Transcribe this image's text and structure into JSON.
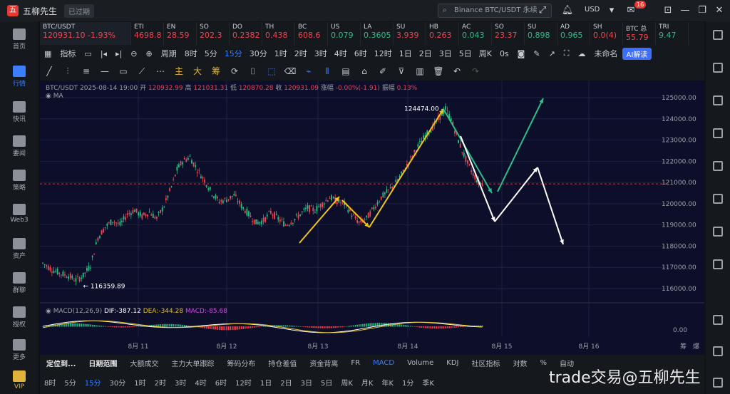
{
  "app": {
    "title": "五柳先生",
    "expired_label": "已过期"
  },
  "search": {
    "placeholder": "Binance BTC/USDT 永续"
  },
  "header": {
    "currency": "USD",
    "notif_count": "16"
  },
  "sidebar": {
    "items": [
      {
        "label": "首页"
      },
      {
        "label": "行情"
      },
      {
        "label": "快讯"
      },
      {
        "label": "要闻"
      },
      {
        "label": "策略"
      },
      {
        "label": "Web3"
      },
      {
        "label": "资产"
      },
      {
        "label": "群聊"
      },
      {
        "label": "授权"
      },
      {
        "label": "更多"
      },
      {
        "label": "VIP"
      }
    ]
  },
  "tickers": [
    {
      "sym": "BTC/USDT",
      "px": "120931.10 -1.93%",
      "dir": "red"
    },
    {
      "sym": "ETI",
      "px": "4698.8",
      "dir": "red"
    },
    {
      "sym": "EN",
      "px": "28.59",
      "dir": "red"
    },
    {
      "sym": "SO",
      "px": "202.3",
      "dir": "red"
    },
    {
      "sym": "DO",
      "px": "0.2382",
      "dir": "red"
    },
    {
      "sym": "TH",
      "px": "0.438",
      "dir": "red"
    },
    {
      "sym": "BC",
      "px": "608.6",
      "dir": "red"
    },
    {
      "sym": "US",
      "px": "0.079",
      "dir": "green"
    },
    {
      "sym": "LA",
      "px": "0.3605",
      "dir": "green"
    },
    {
      "sym": "SU",
      "px": "3.939",
      "dir": "red"
    },
    {
      "sym": "HB",
      "px": "0.263",
      "dir": "red"
    },
    {
      "sym": "AC",
      "px": "0.043",
      "dir": "green"
    },
    {
      "sym": "SO",
      "px": "23.37",
      "dir": "red"
    },
    {
      "sym": "SU",
      "px": "0.898",
      "dir": "green"
    },
    {
      "sym": "AD",
      "px": "0.965",
      "dir": "green"
    },
    {
      "sym": "SH",
      "px": "0.0(4)",
      "dir": "red"
    },
    {
      "sym": "BTC 总",
      "px": "55.79",
      "dir": "red"
    },
    {
      "sym": "TRI",
      "px": "9.47",
      "dir": "green"
    }
  ],
  "toolbar": {
    "indicators": "指标",
    "period": "周期",
    "periods": [
      "8时",
      "5分",
      "15分",
      "30分",
      "1时",
      "2时",
      "3时",
      "4时",
      "6时",
      "12时",
      "1日",
      "2日",
      "3日",
      "5日",
      "周K"
    ],
    "active_period": "15分",
    "countdown": "0s",
    "layout_name": "未命名",
    "ai_label": "AI解读"
  },
  "drawtools": {
    "labels": [
      "主",
      "大",
      "筹"
    ]
  },
  "chart_info": {
    "symbol": "BTC/USDT",
    "datetime": "2025-08-14 19:00",
    "open_label": "开",
    "open": "120932.99",
    "high_label": "高",
    "high": "121031.31",
    "low_label": "低",
    "low": "120870.28",
    "close_label": "收",
    "close": "120931.09",
    "change_label": "涨幅",
    "change": "-0.00%(-1.91)",
    "amp_label": "振幅",
    "amp": "0.13%",
    "ma_label": "MA"
  },
  "macd": {
    "label": "MACD(12,26,9)",
    "dif": "DIF:-387.12",
    "dea": "DEA:-344.28",
    "macd": "MACD:-85.68"
  },
  "chart_data": {
    "type": "candlestick",
    "y_ticks": [
      125000,
      124000,
      123000,
      122000,
      121000,
      120000,
      119000,
      118000,
      117000,
      116000
    ],
    "x_ticks": [
      "8月 11",
      "8月 12",
      "8月 13",
      "8月 14",
      "8月 15",
      "8月 16"
    ],
    "macd_ticks": [
      "0.00"
    ],
    "annotations": {
      "high_label": "124474.00",
      "low_label": "116359.89",
      "current_price": 120931.1
    },
    "right_labels": [
      "筹",
      "爆"
    ],
    "price_path": [
      [
        0,
        117200
      ],
      [
        5,
        116900
      ],
      [
        10,
        116700
      ],
      [
        14,
        116600
      ],
      [
        18,
        116400
      ],
      [
        22,
        116600
      ],
      [
        26,
        117100
      ],
      [
        30,
        118400
      ],
      [
        34,
        118900
      ],
      [
        38,
        119200
      ],
      [
        42,
        119000
      ],
      [
        46,
        119500
      ],
      [
        50,
        119700
      ],
      [
        54,
        119400
      ],
      [
        58,
        119600
      ],
      [
        62,
        119300
      ],
      [
        66,
        119900
      ],
      [
        70,
        120800
      ],
      [
        73,
        121600
      ],
      [
        76,
        122000
      ],
      [
        80,
        122200
      ],
      [
        84,
        121600
      ],
      [
        88,
        121100
      ],
      [
        92,
        120500
      ],
      [
        96,
        120100
      ],
      [
        100,
        120200
      ],
      [
        104,
        120400
      ],
      [
        108,
        119900
      ],
      [
        112,
        119500
      ],
      [
        116,
        119100
      ],
      [
        120,
        119200
      ],
      [
        124,
        119600
      ],
      [
        128,
        119300
      ],
      [
        132,
        119000
      ],
      [
        136,
        119200
      ],
      [
        140,
        119500
      ],
      [
        144,
        119800
      ],
      [
        148,
        119700
      ],
      [
        152,
        120000
      ],
      [
        156,
        120300
      ],
      [
        160,
        120100
      ],
      [
        164,
        120000
      ],
      [
        168,
        119500
      ],
      [
        172,
        119100
      ],
      [
        176,
        119300
      ],
      [
        180,
        119800
      ],
      [
        184,
        120300
      ],
      [
        188,
        120600
      ],
      [
        192,
        121000
      ],
      [
        196,
        121500
      ],
      [
        200,
        122100
      ],
      [
        204,
        122700
      ],
      [
        208,
        123200
      ],
      [
        212,
        123600
      ],
      [
        216,
        124100
      ],
      [
        219,
        124474
      ],
      [
        222,
        124000
      ],
      [
        225,
        123200
      ],
      [
        228,
        122500
      ],
      [
        231,
        121900
      ],
      [
        234,
        121400
      ],
      [
        237,
        121000
      ],
      [
        240,
        120931
      ]
    ],
    "projection_arrows": [
      "green",
      "white"
    ]
  },
  "bottom_tabs1": [
    "定位到...",
    "日期范围",
    "大额成交",
    "主力大单跟踪",
    "筹码分布",
    "持仓差值",
    "资金背离",
    "FR",
    "MACD",
    "Volume",
    "KDJ",
    "社区指标",
    "对数",
    "%",
    "自动"
  ],
  "bottom_tabs2": [
    "8时",
    "5分",
    "15分",
    "30分",
    "1时",
    "2时",
    "3时",
    "4时",
    "6时",
    "12时",
    "1日",
    "2日",
    "3日",
    "5日",
    "周K",
    "月K",
    "年K",
    "1分",
    "季K"
  ],
  "watermark": "trade交易@五柳先生"
}
